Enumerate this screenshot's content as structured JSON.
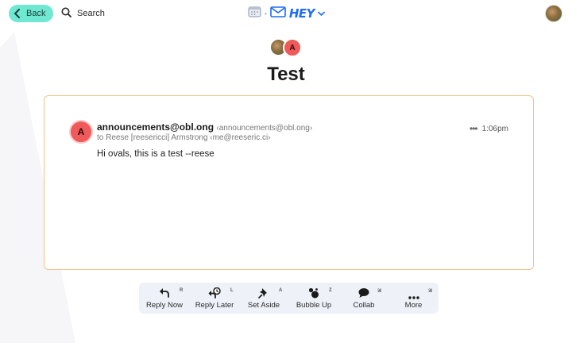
{
  "topbar": {
    "back_label": "Back",
    "search_label": "Search",
    "logo_text": "HEY"
  },
  "thread": {
    "participant_initial": "A",
    "title": "Test"
  },
  "email": {
    "sender_initial": "A",
    "sender_name": "announcements@obl.ong",
    "sender_email": "‹announcements@obl.ong›",
    "to_line": "to Reese [reesericci] Armstrong ‹me@reeseric.ci›",
    "time": "1:06pm",
    "more_dots": "•••",
    "body": "Hi ovals, this is a test --reese"
  },
  "actions": [
    {
      "label": "Reply Now",
      "key": "R",
      "icon": "reply-icon"
    },
    {
      "label": "Reply Later",
      "key": "L",
      "icon": "reply-later-icon"
    },
    {
      "label": "Set Aside",
      "key": "A",
      "icon": "pin-icon"
    },
    {
      "label": "Bubble Up",
      "key": "Z",
      "icon": "bubble-up-icon"
    },
    {
      "label": "Collab",
      "key": "⌘",
      "icon": "chat-bubble-icon"
    },
    {
      "label": "More",
      "key": "⌘",
      "icon": "more-icon"
    }
  ],
  "colors": {
    "accent_teal": "#6fe8d2",
    "brand_blue": "#1c6cf4",
    "avatar_red": "#f05a5a",
    "card_border": "#f4c089",
    "action_bar_bg": "#eef2f8"
  }
}
